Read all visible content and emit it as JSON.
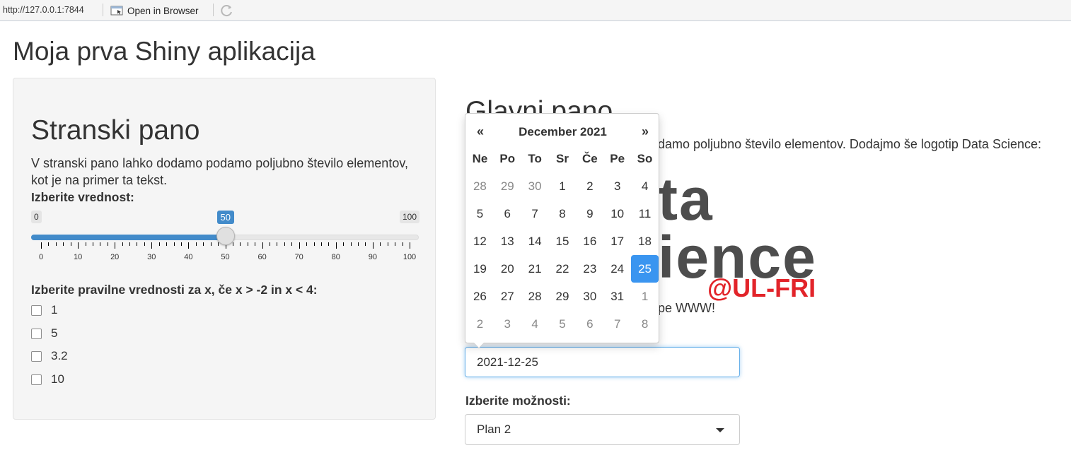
{
  "browser": {
    "url": "http://127.0.0.1:7844",
    "open_label": "Open in Browser"
  },
  "app_title": "Moja prva Shiny aplikacija",
  "sidebar": {
    "title": "Stranski pano",
    "description": "V stranski pano lahko dodamo podamo poljubno število elementov, kot je na primer ta tekst.",
    "slider": {
      "label": "Izberite vrednost:",
      "min": 0,
      "max": 100,
      "value": 50,
      "min_label": "0",
      "max_label": "100",
      "value_label": "50",
      "tick_labels": [
        "0",
        "10",
        "20",
        "30",
        "40",
        "50",
        "60",
        "70",
        "80",
        "90",
        "100"
      ]
    },
    "checkbox_group": {
      "label": "Izberite pravilne vrednosti za x, če x > -2 in x < 4:",
      "options": [
        "1",
        "5",
        "3.2",
        "10"
      ]
    }
  },
  "main": {
    "title": "Glavni pano",
    "text_visible": "damo poljubno število elementov. Dodajmo še logotip Data Science:",
    "logo_line1": "ta",
    "logo_line2": "ience",
    "logo_line3": "@UL-FRI",
    "www_text": "pe WWW!",
    "date_input_value": "2021-12-25",
    "select": {
      "label": "Izberite možnosti:",
      "value": "Plan 2"
    }
  },
  "datepicker": {
    "prev": "«",
    "next": "»",
    "month": "December 2021",
    "weekdays": [
      "Ne",
      "Po",
      "To",
      "Sr",
      "Če",
      "Pe",
      "So"
    ],
    "weeks": [
      [
        "28",
        "29",
        "30",
        "1",
        "2",
        "3",
        "4"
      ],
      [
        "5",
        "6",
        "7",
        "8",
        "9",
        "10",
        "11"
      ],
      [
        "12",
        "13",
        "14",
        "15",
        "16",
        "17",
        "18"
      ],
      [
        "19",
        "20",
        "21",
        "22",
        "23",
        "24",
        "25"
      ],
      [
        "26",
        "27",
        "28",
        "29",
        "30",
        "31",
        "1"
      ],
      [
        "2",
        "3",
        "4",
        "5",
        "6",
        "7",
        "8"
      ]
    ],
    "selected_day": "25"
  },
  "colors": {
    "accent": "#428bca",
    "datepicker_active": "#3a95f0",
    "logo_red": "#e2242a",
    "logo_gray": "#4d4d4d"
  }
}
